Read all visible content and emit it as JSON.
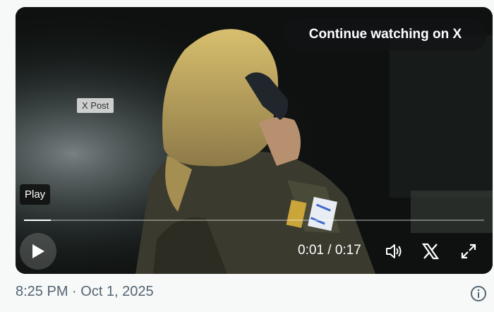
{
  "video": {
    "continue_label": "Continue watching on X",
    "source_label": "X Post",
    "play_tooltip": "Play",
    "time_display": "0:01 / 0:17",
    "progress": 0.059,
    "icons": [
      "play-icon",
      "volume-icon",
      "x-logo-icon",
      "fullscreen-icon"
    ]
  },
  "post": {
    "timestamp": "8:25 PM · Oct 1, 2025",
    "info_icon": "info-icon"
  },
  "colors": {
    "page_bg": "#f7f9f9",
    "meta_text": "#536471",
    "overlay_white": "#ffffff"
  }
}
